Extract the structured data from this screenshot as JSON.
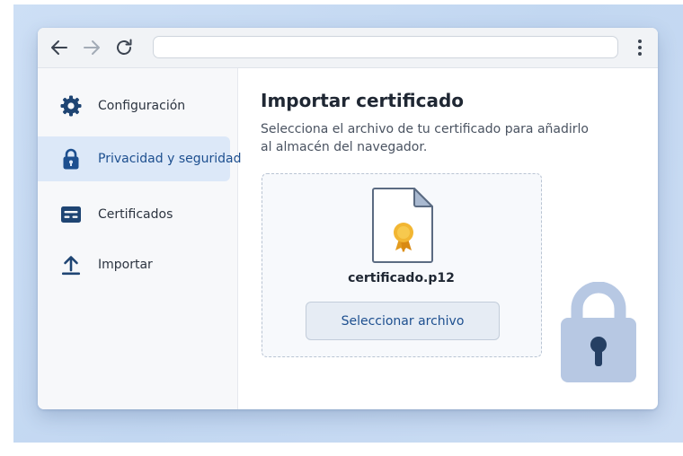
{
  "window": {
    "address_bar": {
      "value": "",
      "placeholder": ""
    }
  },
  "toolbar": {
    "icons": [
      "back-arrow-icon",
      "forward-arrow-icon",
      "reload-icon",
      "more-vertical-icon"
    ]
  },
  "sidebar": {
    "items": [
      {
        "label": "Configuración",
        "icon": "gear-icon",
        "active": false
      },
      {
        "label": "Privacidad y seguridad",
        "icon": "lock-icon",
        "active": true
      },
      {
        "label": "Certificados",
        "icon": "certificate-card-icon",
        "active": false
      },
      {
        "label": "Importar",
        "icon": "upload-icon",
        "active": false
      }
    ]
  },
  "main": {
    "title": "Importar certificado",
    "description": "Selecciona el archivo de tu certificado para añadirlo al almacén del navegador.",
    "dropzone": {
      "file_icon": "certificate-file-icon",
      "file_name": "certificado.p12",
      "button_label": "Seleccionar archivo"
    }
  },
  "decoration": {
    "icon": "padlock-icon"
  },
  "colors": {
    "accent": "#1d4f8f",
    "active_nav_bg": "#dce8f8",
    "icon_dark": "#1f4573",
    "seal_gold": "#f2b632",
    "lock_light": "#b7c8e3"
  }
}
